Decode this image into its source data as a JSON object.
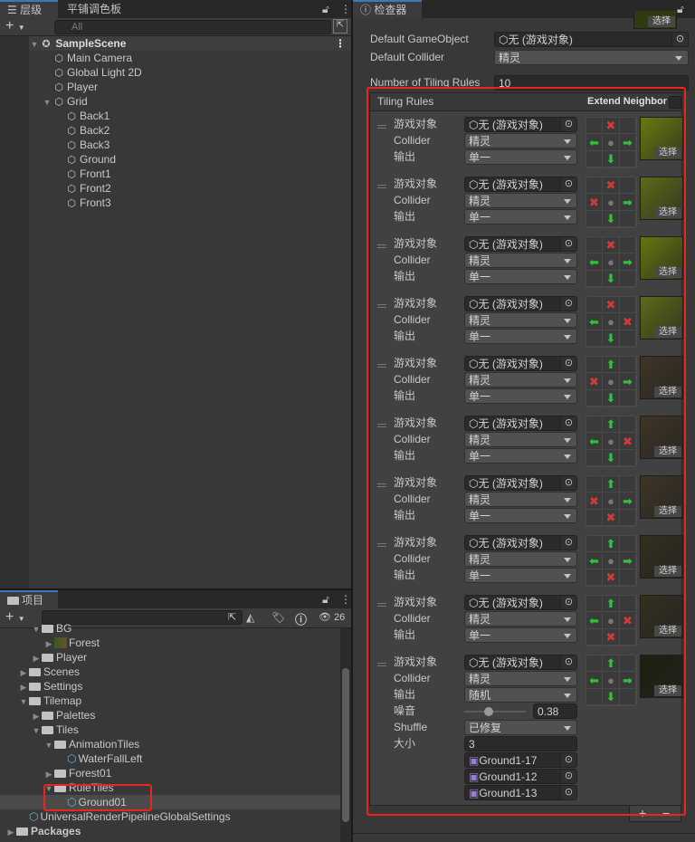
{
  "hierarchy": {
    "tabs": [
      "层级",
      "平铺调色板"
    ],
    "search_placeholder": "All",
    "scene": "SampleScene",
    "items": [
      {
        "label": "Main Camera",
        "depth": 1
      },
      {
        "label": "Global Light 2D",
        "depth": 1
      },
      {
        "label": "Player",
        "depth": 1
      },
      {
        "label": "Grid",
        "depth": 1,
        "expanded": true
      },
      {
        "label": "Back1",
        "depth": 2
      },
      {
        "label": "Back2",
        "depth": 2
      },
      {
        "label": "Back3",
        "depth": 2
      },
      {
        "label": "Ground",
        "depth": 2
      },
      {
        "label": "Front1",
        "depth": 2
      },
      {
        "label": "Front2",
        "depth": 2
      },
      {
        "label": "Front3",
        "depth": 2
      }
    ]
  },
  "project": {
    "tab": "项目",
    "hidden_count": "26",
    "items": [
      {
        "label": "BG",
        "depth": 2,
        "type": "folder",
        "tri": "down"
      },
      {
        "label": "Forest",
        "depth": 3,
        "type": "image",
        "tri": "right"
      },
      {
        "label": "Player",
        "depth": 2,
        "type": "folder",
        "tri": "right"
      },
      {
        "label": "Scenes",
        "depth": 1,
        "type": "folder",
        "tri": "right"
      },
      {
        "label": "Settings",
        "depth": 1,
        "type": "folder",
        "tri": "right"
      },
      {
        "label": "Tilemap",
        "depth": 1,
        "type": "folder",
        "tri": "down"
      },
      {
        "label": "Palettes",
        "depth": 2,
        "type": "folder",
        "tri": "right"
      },
      {
        "label": "Tiles",
        "depth": 2,
        "type": "folder",
        "tri": "down"
      },
      {
        "label": "AnimationTiles",
        "depth": 3,
        "type": "folder",
        "tri": "down"
      },
      {
        "label": "WaterFallLeft",
        "depth": 4,
        "type": "asset"
      },
      {
        "label": "Forest01",
        "depth": 3,
        "type": "folder",
        "tri": "right"
      },
      {
        "label": "RuleTiles",
        "depth": 3,
        "type": "folder",
        "tri": "down"
      },
      {
        "label": "Ground01",
        "depth": 4,
        "type": "asset",
        "selected": true
      },
      {
        "label": "UniversalRenderPipelineGlobalSettings",
        "depth": 1,
        "type": "asset"
      },
      {
        "label": "Packages",
        "depth": 0,
        "type": "folder",
        "tri": "right",
        "bold": true
      }
    ]
  },
  "inspector": {
    "tab": "检查器",
    "select_label": "选择",
    "default_gameobject_label": "Default GameObject",
    "default_gameobject_value": "无 (游戏对象)",
    "default_collider_label": "Default Collider",
    "default_collider_value": "精灵",
    "num_rules_label": "Number of Tiling Rules",
    "num_rules_value": "10",
    "tiling_rules_label": "Tiling Rules",
    "extend_neighbor_label": "Extend Neighbor",
    "labels": {
      "gameobject": "游戏对象",
      "collider": "Collider",
      "output": "输出",
      "noise": "噪音",
      "shuffle": "Shuffle",
      "size": "大小"
    },
    "rules": [
      {
        "gameobject": "无 (游戏对象)",
        "collider": "精灵",
        "output": "单一",
        "neighbors": {
          "up": "x",
          "left": "g",
          "right": "g",
          "down": "g"
        },
        "preview": "#6a7a10"
      },
      {
        "gameobject": "无 (游戏对象)",
        "collider": "精灵",
        "output": "单一",
        "neighbors": {
          "up": "x",
          "left": "x",
          "right": "g",
          "down": "g"
        },
        "preview": "#5f6a18"
      },
      {
        "gameobject": "无 (游戏对象)",
        "collider": "精灵",
        "output": "单一",
        "neighbors": {
          "up": "x",
          "left": "g",
          "right": "g",
          "down": "g"
        },
        "preview": "#667510"
      },
      {
        "gameobject": "无 (游戏对象)",
        "collider": "精灵",
        "output": "单一",
        "neighbors": {
          "up": "x",
          "left": "g",
          "right": "x",
          "down": "g"
        },
        "preview": "#5f6a18"
      },
      {
        "gameobject": "无 (游戏对象)",
        "collider": "精灵",
        "output": "单一",
        "neighbors": {
          "up": "g",
          "left": "x",
          "right": "g",
          "down": "g"
        },
        "preview": "#3e3526"
      },
      {
        "gameobject": "无 (游戏对象)",
        "collider": "精灵",
        "output": "单一",
        "neighbors": {
          "up": "g",
          "left": "g",
          "right": "x",
          "down": "g"
        },
        "preview": "#3e3526"
      },
      {
        "gameobject": "无 (游戏对象)",
        "collider": "精灵",
        "output": "单一",
        "neighbors": {
          "up": "g",
          "left": "x",
          "right": "g",
          "down": "x"
        },
        "preview": "#3e3526"
      },
      {
        "gameobject": "无 (游戏对象)",
        "collider": "精灵",
        "output": "单一",
        "neighbors": {
          "up": "g",
          "left": "g",
          "right": "g",
          "down": "x"
        },
        "preview": "#33301f"
      },
      {
        "gameobject": "无 (游戏对象)",
        "collider": "精灵",
        "output": "单一",
        "neighbors": {
          "up": "g",
          "left": "g",
          "right": "x",
          "down": "x"
        },
        "preview": "#33301f"
      },
      {
        "gameobject": "无 (游戏对象)",
        "collider": "精灵",
        "output": "随机",
        "neighbors": {
          "up": "g",
          "left": "g",
          "right": "g",
          "down": "g"
        },
        "preview": "#1e2010",
        "noise": "0.38",
        "noise_fraction": 0.38,
        "shuffle": "已修复",
        "size": "3",
        "sprites": [
          "Ground1-17",
          "Ground1-12",
          "Ground1-13"
        ]
      }
    ],
    "add_label": "+",
    "remove_label": "−"
  },
  "colors": {
    "accent": "#3a79bb",
    "highlight_box": "#e8261e",
    "green": "#2ec23a",
    "red": "#d23a3a"
  }
}
